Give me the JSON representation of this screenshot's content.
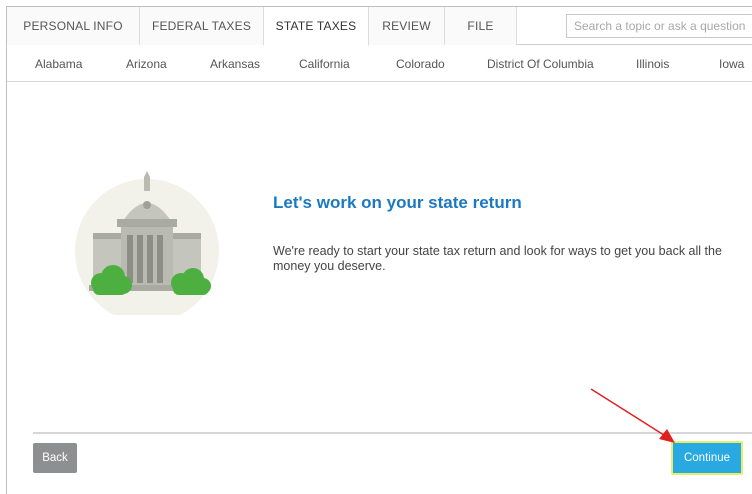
{
  "tabs": [
    {
      "label": "PERSONAL INFO",
      "active": false
    },
    {
      "label": "FEDERAL TAXES",
      "active": false
    },
    {
      "label": "STATE TAXES",
      "active": true
    },
    {
      "label": "REVIEW",
      "active": false
    },
    {
      "label": "FILE",
      "active": false
    }
  ],
  "search": {
    "placeholder": "Search a topic or ask a question"
  },
  "states": [
    "Alabama",
    "Arizona",
    "Arkansas",
    "California",
    "Colorado",
    "District Of Columbia",
    "Illinois",
    "Iowa"
  ],
  "main": {
    "heading": "Let's work on your state return",
    "description": "We're ready to start your state tax return and look for ways to get you back all the money you deserve."
  },
  "buttons": {
    "back": "Back",
    "continue": "Continue"
  },
  "colors": {
    "heading": "#1b79c2",
    "continue_bg": "#29a9e1",
    "continue_border": "#e5f06a",
    "back_bg": "#8d8f91",
    "annotation_arrow": "#e02020",
    "building": "#b9bab0",
    "cloud": "#4caf3f"
  },
  "icons": {
    "illustration": "state-capitol-building-icon",
    "annotation": "red-arrow-annotation"
  }
}
